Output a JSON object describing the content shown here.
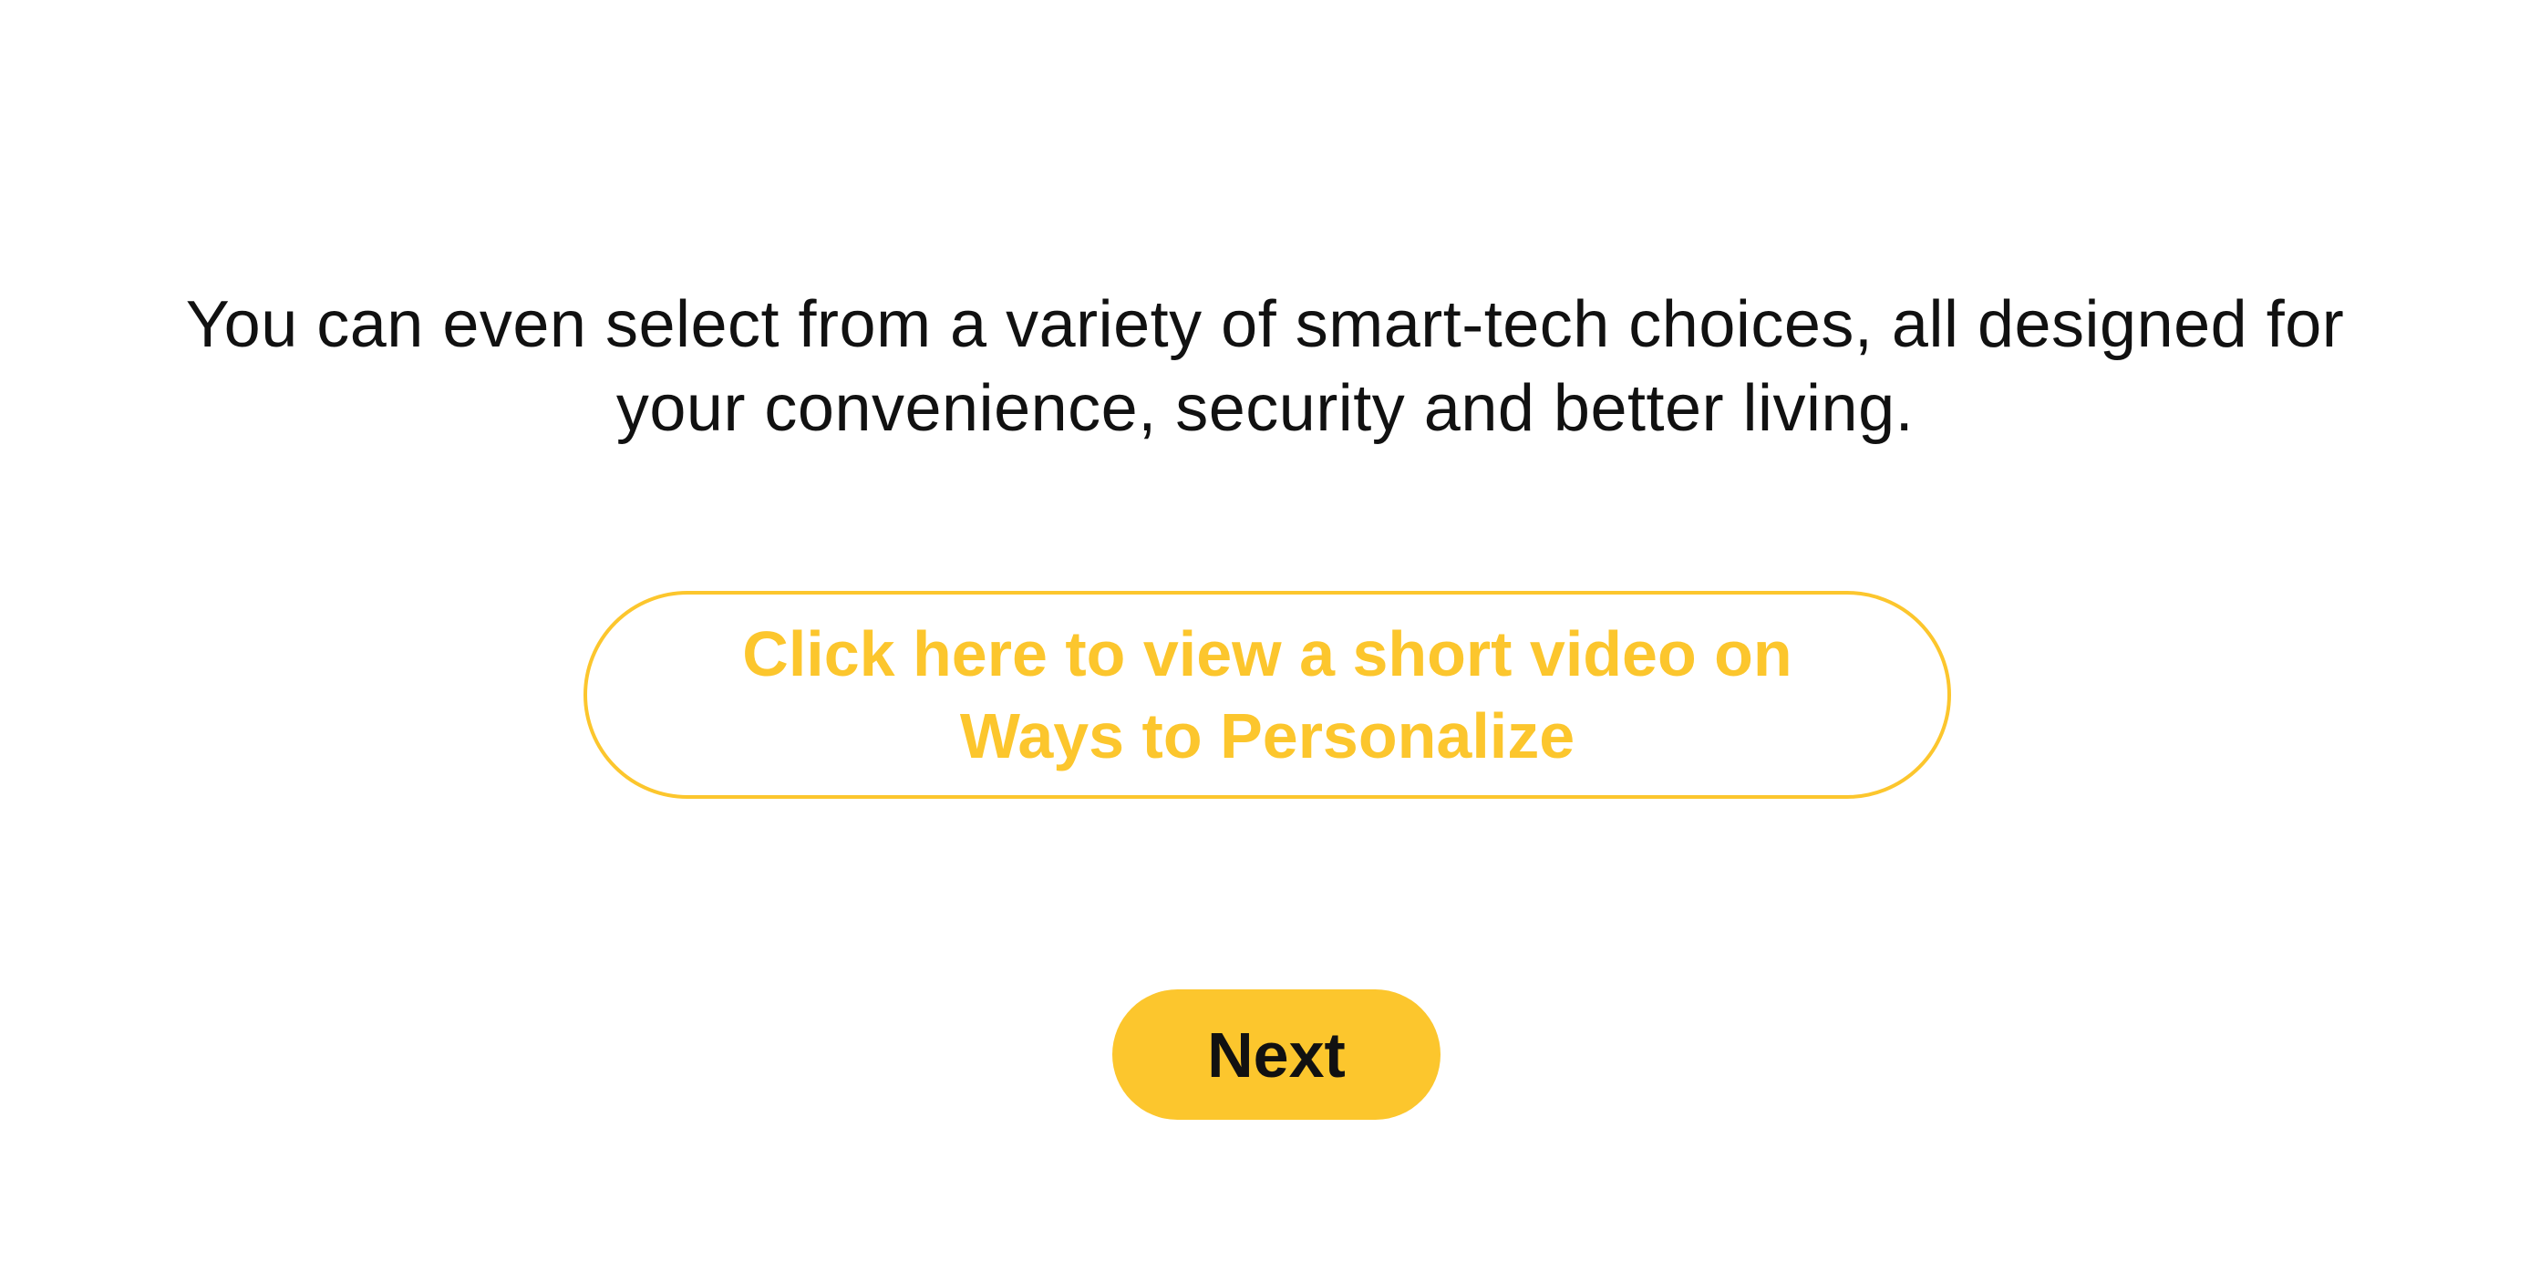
{
  "intro": {
    "line1": "You can even select from a variety of smart-tech choices, all designed for",
    "line2": "your convenience, security and better living."
  },
  "video_button": {
    "line1": "Click here to view a short video on",
    "line2": "Ways to Personalize"
  },
  "next_button": {
    "label": "Next"
  },
  "colors": {
    "accent": "#fcc62d",
    "text": "#111111",
    "background": "#ffffff"
  }
}
